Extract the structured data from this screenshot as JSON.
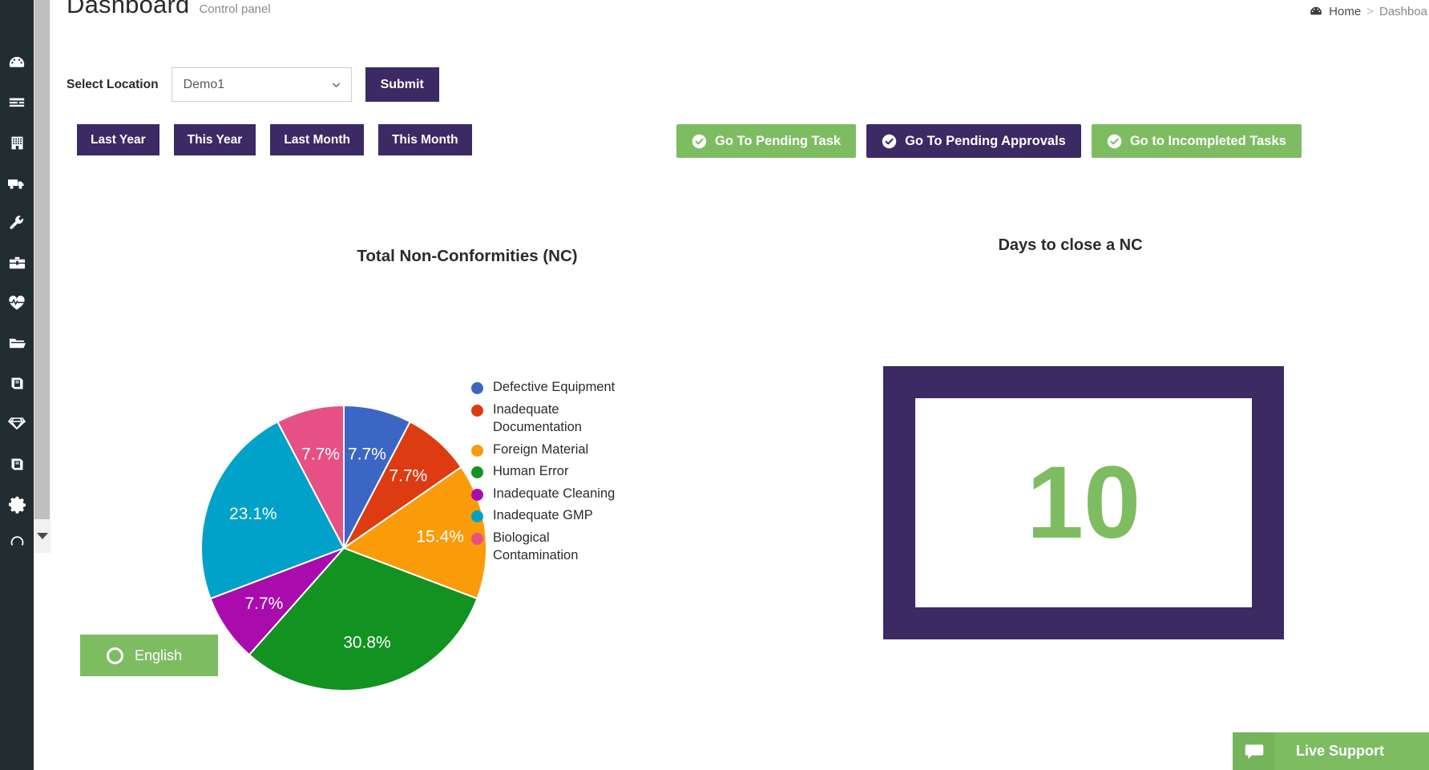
{
  "header": {
    "title": "Dashboard",
    "subtitle": "Control panel",
    "breadcrumb": {
      "home": "Home",
      "separator": ">",
      "current": "Dashboa",
      "home_icon": "dashboard-gauge-icon"
    }
  },
  "filters": {
    "location_label": "Select Location",
    "location_value": "Demo1",
    "location_options": [
      "Demo1"
    ],
    "submit_label": "Submit",
    "chevron_icon": "chevron-down-icon"
  },
  "periods": [
    {
      "label": "Last Year"
    },
    {
      "label": "This Year"
    },
    {
      "label": "Last Month"
    },
    {
      "label": "This Month"
    }
  ],
  "actions": [
    {
      "label": "Go To Pending Task",
      "style": "green",
      "icon": "check-circle-icon"
    },
    {
      "label": "Go To Pending Approvals",
      "style": "purple",
      "icon": "check-circle-icon"
    },
    {
      "label": "Go to Incompleted Tasks",
      "style": "green",
      "icon": "check-circle-icon"
    }
  ],
  "sidebar": {
    "items": [
      {
        "icon": "dashboard-gauge-icon"
      },
      {
        "icon": "list-lines-icon"
      },
      {
        "icon": "building-icon"
      },
      {
        "icon": "truck-icon"
      },
      {
        "icon": "wrench-icon"
      },
      {
        "icon": "toolbox-icon"
      },
      {
        "icon": "heartbeat-icon"
      },
      {
        "icon": "folder-open-icon"
      },
      {
        "icon": "book-icon"
      },
      {
        "icon": "gem-diamond-icon"
      },
      {
        "icon": "book-icon"
      },
      {
        "icon": "gear-icon"
      },
      {
        "icon": "partial-circle-icon"
      }
    ],
    "scroll_down_icon": "scroll-down-arrow-icon"
  },
  "language_button": {
    "label": "English",
    "icon": "radio-circle-icon"
  },
  "live_support": {
    "label": "Live Support",
    "icon": "chat-bubble-icon"
  },
  "days_panel": {
    "title": "Days to close a NC",
    "value": "10"
  },
  "chart_data": {
    "type": "pie",
    "title": "Total Non-Conformities (NC)",
    "categories": [
      "Defective Equipment",
      "Inadequate Documentation",
      "Foreign Material",
      "Human Error",
      "Inadequate Cleaning",
      "Inadequate GMP",
      "Biological Contamination"
    ],
    "values": [
      7.7,
      7.7,
      15.4,
      30.8,
      7.7,
      23.1,
      7.7
    ],
    "labels": [
      "7.7%",
      "7.7%",
      "15.4%",
      "30.8%",
      "7.7%",
      "23.1%",
      "7.7%"
    ],
    "colors": [
      "#3b66c4",
      "#dd3b11",
      "#fa9b0a",
      "#129221",
      "#aa0bad",
      "#01a2c9",
      "#e65084"
    ],
    "legend_position": "right",
    "grid": false,
    "xlabel": "",
    "ylabel": ""
  }
}
